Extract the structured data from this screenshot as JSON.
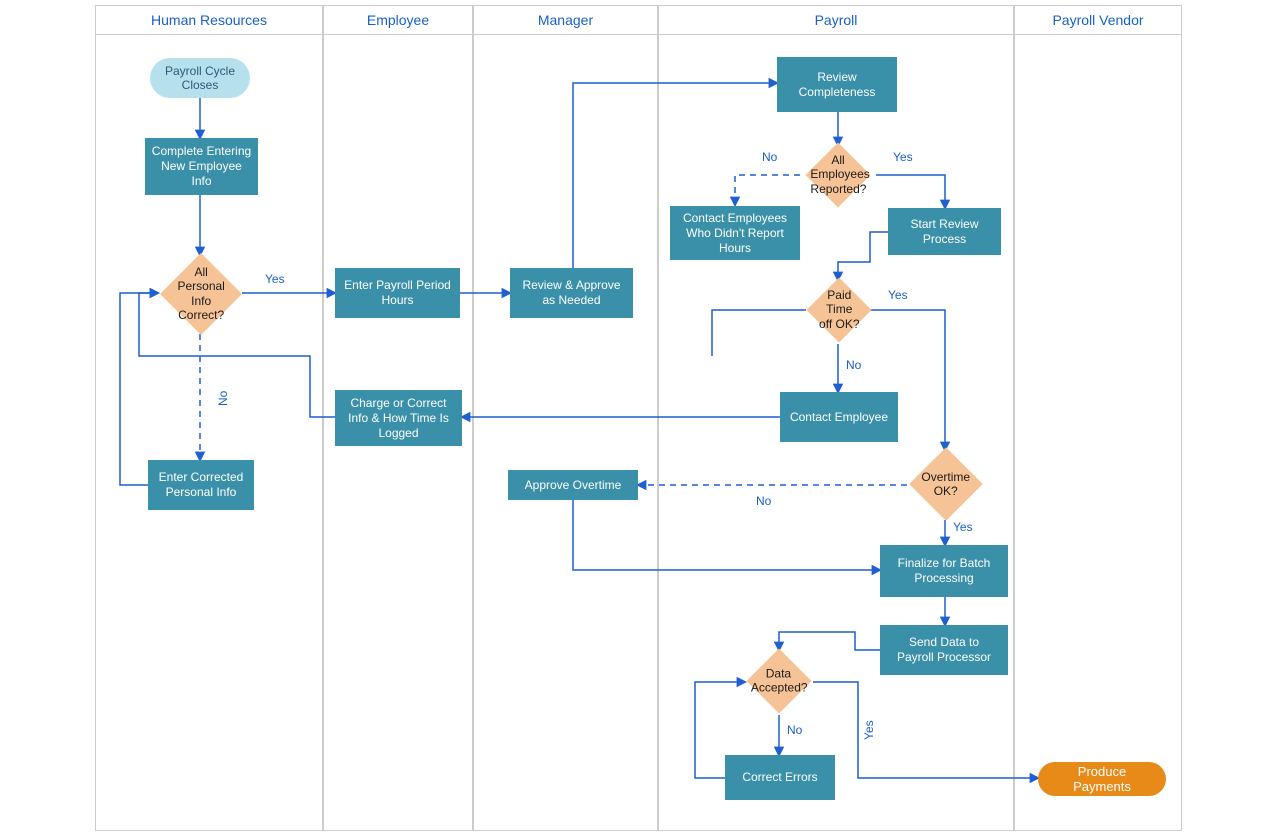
{
  "lanes": {
    "hr": "Human Resources",
    "emp": "Employee",
    "mgr": "Manager",
    "payroll": "Payroll",
    "vendor": "Payroll Vendor"
  },
  "nodes": {
    "start": "Payroll Cycle\nCloses",
    "completeEnter": "Complete Entering\nNew Employee\nInfo",
    "allPersonal": "All\nPersonal Info\nCorrect?",
    "enterCorrected": "Enter Corrected\nPersonal Info",
    "enterHours": "Enter Payroll Period\nHours",
    "chargeCorrect": "Charge or Correct\nInfo & How Time Is\nLogged",
    "reviewApprove": "Review & Approve\nas Needed",
    "approveOT": "Approve Overtime",
    "reviewCompleteness": "Review\nCompleteness",
    "allReported": "All Employees\nReported?",
    "contactNoReport": "Contact Employees\nWho Didn't Report\nHours",
    "startReview": "Start Review\nProcess",
    "paidTimeOff": "Paid Time\noff OK?",
    "contactEmp": "Contact Employee",
    "overtimeOK": "Overtime OK?",
    "finalize": "Finalize for Batch\nProcessing",
    "sendData": "Send Data to\nPayroll Processor",
    "dataAccepted": "Data\nAccepted?",
    "correctErrors": "Correct Errors",
    "producePayments": "Produce Payments"
  },
  "labels": {
    "yes": "Yes",
    "no": "No"
  },
  "colors": {
    "laneBorder": "#cccccc",
    "laneText": "#1860c8",
    "process": "#3a90a9",
    "decision": "#f6c396",
    "terminatorStart": "#b6e1ec",
    "terminatorOrange": "#e88a18",
    "connector": "#1f5fcf"
  }
}
